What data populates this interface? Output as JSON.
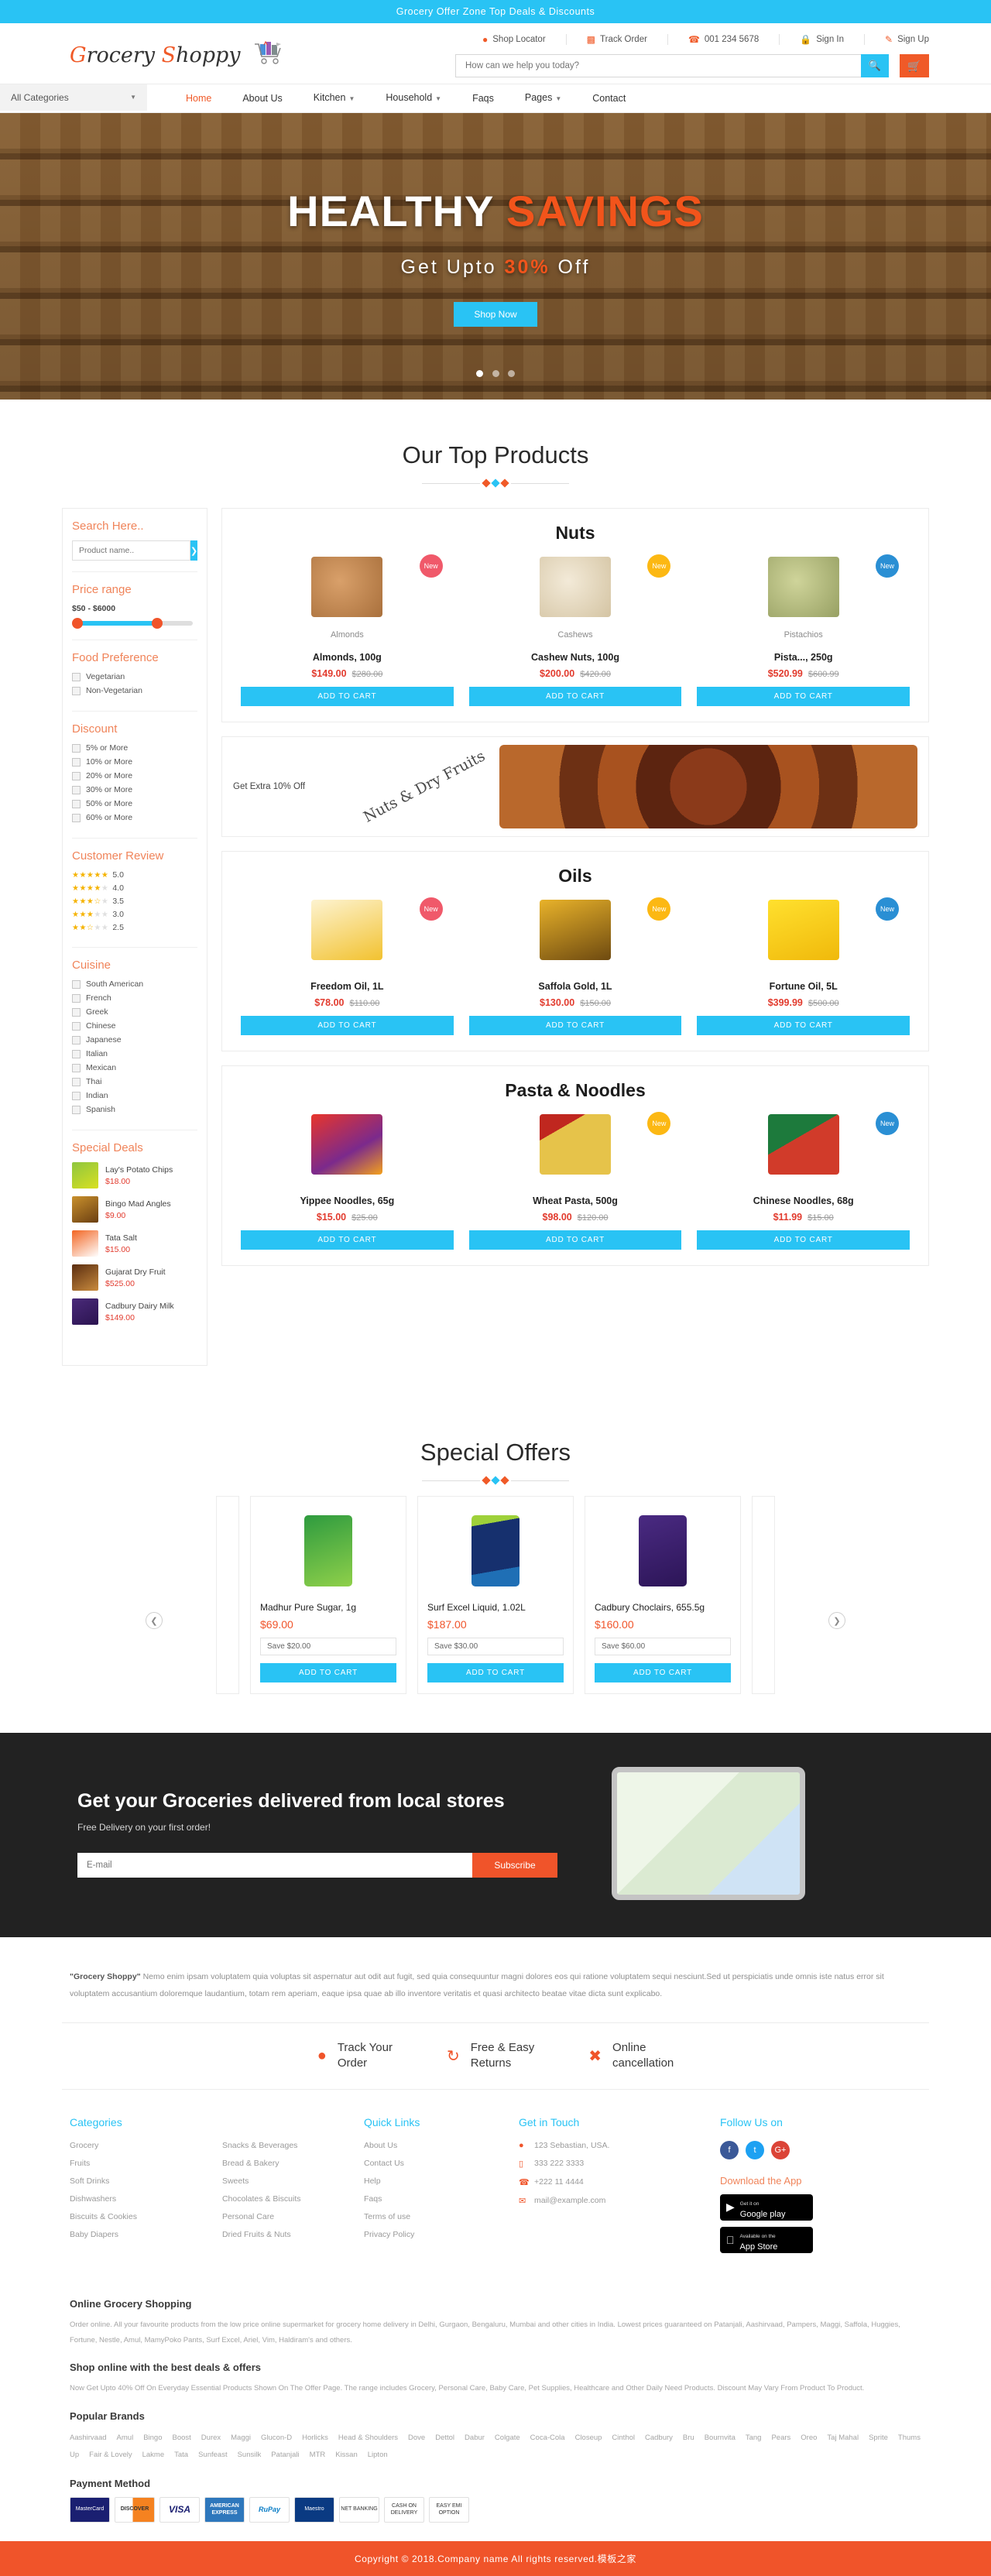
{
  "announcement": "Grocery Offer Zone Top Deals & Discounts",
  "brand": {
    "part1": "G",
    "part2": "rocery ",
    "part3": "S",
    "part4": "hoppy",
    "cart_icon": "shopping-cart-icon"
  },
  "utility": [
    {
      "icon": "location-pin-icon",
      "label": "Shop Locator"
    },
    {
      "icon": "truck-icon",
      "label": "Track Order"
    },
    {
      "icon": "phone-icon",
      "label": "001 234 5678"
    },
    {
      "icon": "lock-icon",
      "label": "Sign In"
    },
    {
      "icon": "pencil-icon",
      "label": "Sign Up"
    }
  ],
  "search": {
    "placeholder": "How can we help you today?",
    "value": "",
    "button_icon": "search-icon"
  },
  "cart_button": {
    "icon": "cart-icon"
  },
  "nav": {
    "categories_label": "All Categories",
    "links": [
      {
        "label": "Home",
        "active": true,
        "caret": false
      },
      {
        "label": "About Us",
        "active": false,
        "caret": false
      },
      {
        "label": "Kitchen",
        "active": false,
        "caret": true
      },
      {
        "label": "Household",
        "active": false,
        "caret": true
      },
      {
        "label": "Faqs",
        "active": false,
        "caret": false
      },
      {
        "label": "Pages",
        "active": false,
        "caret": true
      },
      {
        "label": "Contact",
        "active": false,
        "caret": false
      }
    ]
  },
  "hero": {
    "title_white": "HEALTHY ",
    "title_orange": "SAVINGS",
    "subtitle_pre": "Get Upto ",
    "subtitle_strong": "30%",
    "subtitle_post": " Off",
    "button": "Shop Now",
    "dots": 3,
    "active_dot": 0
  },
  "top_products": {
    "title": "Our Top Products"
  },
  "sidebar": {
    "search_title": "Search Here..",
    "search_placeholder": "Product name..",
    "search_button_icon": "chevron-right-icon",
    "price_title": "Price range",
    "price_min": "$50",
    "price_sep": "-",
    "price_max": "$6000",
    "food_title": "Food Preference",
    "food_options": [
      "Vegetarian",
      "Non-Vegetarian"
    ],
    "discount_title": "Discount",
    "discount_options": [
      "5% or More",
      "10% or More",
      "20% or More",
      "30% or More",
      "50% or More",
      "60% or More"
    ],
    "review_title": "Customer Review",
    "reviews": [
      {
        "full": 5,
        "half": 0,
        "value": "5.0"
      },
      {
        "full": 4,
        "half": 0,
        "value": "4.0"
      },
      {
        "full": 3,
        "half": 1,
        "value": "3.5"
      },
      {
        "full": 3,
        "half": 0,
        "value": "3.0"
      },
      {
        "full": 2,
        "half": 1,
        "value": "2.5"
      }
    ],
    "cuisine_title": "Cuisine",
    "cuisine_options": [
      "South American",
      "French",
      "Greek",
      "Chinese",
      "Japanese",
      "Italian",
      "Mexican",
      "Thai",
      "Indian",
      "Spanish"
    ],
    "deals_title": "Special Deals",
    "deals": [
      {
        "name": "Lay's Potato Chips",
        "price": "$18.00"
      },
      {
        "name": "Bingo Mad Angles",
        "price": "$9.00"
      },
      {
        "name": "Tata Salt",
        "price": "$15.00"
      },
      {
        "name": "Gujarat Dry Fruit",
        "price": "$525.00"
      },
      {
        "name": "Cadbury Dairy Milk",
        "price": "$149.00"
      }
    ]
  },
  "panels": [
    {
      "title": "Nuts",
      "products": [
        {
          "caption": "Almonds",
          "name": "Almonds, 100g",
          "price": "$149.00",
          "old_price": "$280.00",
          "badge": "New",
          "badge_color": "red",
          "cta": "ADD TO CART"
        },
        {
          "caption": "Cashews",
          "name": "Cashew Nuts, 100g",
          "price": "$200.00",
          "old_price": "$420.00",
          "badge": "New",
          "badge_color": "yel",
          "cta": "ADD TO CART"
        },
        {
          "caption": "Pistachios",
          "name": "Pista..., 250g",
          "price": "$520.99",
          "old_price": "$600.99",
          "badge": "New",
          "badge_color": "blu",
          "cta": "ADD TO CART"
        }
      ]
    },
    {
      "title": "Oils",
      "products": [
        {
          "caption": "",
          "name": "Freedom Oil, 1L",
          "price": "$78.00",
          "old_price": "$110.00",
          "badge": "New",
          "badge_color": "red",
          "cta": "ADD TO CART"
        },
        {
          "caption": "",
          "name": "Saffola Gold, 1L",
          "price": "$130.00",
          "old_price": "$150.00",
          "badge": "New",
          "badge_color": "yel",
          "cta": "ADD TO CART"
        },
        {
          "caption": "",
          "name": "Fortune Oil, 5L",
          "price": "$399.99",
          "old_price": "$500.00",
          "badge": "New",
          "badge_color": "blu",
          "cta": "ADD TO CART"
        }
      ]
    },
    {
      "title": "Pasta & Noodles",
      "products": [
        {
          "caption": "",
          "name": "Yippee Noodles, 65g",
          "price": "$15.00",
          "old_price": "$25.00",
          "badge": "",
          "badge_color": "",
          "cta": "ADD TO CART"
        },
        {
          "caption": "",
          "name": "Wheat Pasta, 500g",
          "price": "$98.00",
          "old_price": "$120.00",
          "badge": "New",
          "badge_color": "yel",
          "cta": "ADD TO CART"
        },
        {
          "caption": "",
          "name": "Chinese Noodles, 68g",
          "price": "$11.99",
          "old_price": "$15.00",
          "badge": "New",
          "badge_color": "blu",
          "cta": "ADD TO CART"
        }
      ]
    }
  ],
  "promo": {
    "text": "Get Extra 10% Off",
    "word": "Nuts & Dry Fruits"
  },
  "special_offers": {
    "title": "Special Offers",
    "prev_icon": "chevron-left-icon",
    "next_icon": "chevron-right-icon",
    "items": [
      {
        "name": "Madhur Pure Sugar, 1g",
        "price": "$69.00",
        "save": "Save $20.00",
        "cta": "ADD TO CART"
      },
      {
        "name": "Surf Excel Liquid, 1.02L",
        "price": "$187.00",
        "save": "Save $30.00",
        "cta": "ADD TO CART"
      },
      {
        "name": "Cadbury Choclairs, 655.5g",
        "price": "$160.00",
        "save": "Save $60.00",
        "cta": "ADD TO CART"
      }
    ]
  },
  "newsletter": {
    "title": "Get your Groceries delivered from local stores",
    "subtitle": "Free Delivery on your first order!",
    "placeholder": "E-mail",
    "value": "",
    "button": "Subscribe"
  },
  "footer": {
    "about_brand": "\"Grocery Shoppy\"",
    "about_text": " Nemo enim ipsam voluptatem quia voluptas sit aspernatur aut odit aut fugit, sed quia consequuntur magni dolores eos qui ratione voluptatem sequi nesciunt.Sed ut perspiciatis unde omnis iste natus error sit voluptatem accusantium doloremque laudantium, totam rem aperiam, eaque ipsa quae ab illo inventore veritatis et quasi architecto beatae vitae dicta sunt explicabo.",
    "features": [
      {
        "icon": "location-pin-icon",
        "line1": "Track Your",
        "line2": "Order"
      },
      {
        "icon": "refresh-icon",
        "line1": "Free & Easy",
        "line2": "Returns"
      },
      {
        "icon": "close-x-icon",
        "line1": "Online",
        "line2": "cancellation"
      }
    ],
    "categories_title": "Categories",
    "categories_col1": [
      "Grocery",
      "Fruits",
      "Soft Drinks",
      "Dishwashers",
      "Biscuits & Cookies",
      "Baby Diapers"
    ],
    "categories_col2": [
      "Snacks & Beverages",
      "Bread & Bakery",
      "Sweets",
      "Chocolates & Biscuits",
      "Personal Care",
      "Dried Fruits & Nuts"
    ],
    "quick_title": "Quick Links",
    "quick_links": [
      "About Us",
      "Contact Us",
      "Help",
      "Faqs",
      "Terms of use",
      "Privacy Policy"
    ],
    "touch_title": "Get in Touch",
    "touch_items": [
      {
        "icon": "location-pin-icon",
        "label": "123 Sebastian, USA."
      },
      {
        "icon": "mobile-icon",
        "label": "333 222 3333"
      },
      {
        "icon": "phone-icon",
        "label": "+222 11 4444"
      },
      {
        "icon": "envelope-icon",
        "label": "mail@example.com"
      }
    ],
    "social_title": "Follow Us on",
    "socials": [
      {
        "name": "facebook-icon",
        "glyph": "f"
      },
      {
        "name": "twitter-icon",
        "glyph": "t"
      },
      {
        "name": "google-plus-icon",
        "glyph": "G+"
      }
    ],
    "download_title": "Download the App",
    "stores": [
      {
        "icon": "google-play-icon",
        "small": "Get it on",
        "big": "Google play"
      },
      {
        "icon": "apple-icon",
        "small": "Available on the",
        "big": "App Store"
      }
    ],
    "seo": [
      {
        "heading": "Online Grocery Shopping",
        "body": "Order online. All your favourite products from the low price online supermarket for grocery home delivery in Delhi, Gurgaon, Bengaluru, Mumbai and other cities in India. Lowest prices guaranteed on Patanjali, Aashirvaad, Pampers, Maggi, Saffola, Huggies, Fortune, Nestle, Amul, MamyPoko Pants, Surf Excel, Ariel, Vim, Haldiram's and others."
      },
      {
        "heading": "Shop online with the best deals & offers",
        "body": "Now Get Upto 40% Off On Everyday Essential Products Shown On The Offer Page. The range includes Grocery, Personal Care, Baby Care, Pet Supplies, Healthcare and Other Daily Need Products. Discount May Vary From Product To Product."
      }
    ],
    "brands_title": "Popular Brands",
    "brands": [
      "Aashirvaad",
      "Amul",
      "Bingo",
      "Boost",
      "Durex",
      "Maggi",
      "Glucon-D",
      "Horlicks",
      "Head & Shoulders",
      "Dove",
      "Dettol",
      "Dabur",
      "Colgate",
      "Coca-Cola",
      "Closeup",
      "Cinthol",
      "Cadbury",
      "Bru",
      "Bournvita",
      "Tang",
      "Pears",
      "Oreo",
      "Taj Mahal",
      "Sprite",
      "Thums Up",
      "Fair & Lovely",
      "Lakme",
      "Tata",
      "Sunfeast",
      "Sunsilk",
      "Patanjali",
      "MTR",
      "Kissan",
      "Lipton"
    ],
    "payment_title": "Payment Method",
    "payments": [
      {
        "name": "mastercard-icon",
        "label": "MasterCard"
      },
      {
        "name": "discover-icon",
        "label": "DISCOVER"
      },
      {
        "name": "visa-icon",
        "label": "VISA"
      },
      {
        "name": "amex-icon",
        "label": "AMERICAN EXPRESS"
      },
      {
        "name": "rupay-icon",
        "label": "RuPay"
      },
      {
        "name": "maestro-icon",
        "label": "Maestro"
      },
      {
        "name": "net-banking-icon",
        "label": "NET BANKING"
      },
      {
        "name": "cash-on-delivery-icon",
        "label": "CASH ON DELIVERY"
      },
      {
        "name": "easy-emi-icon",
        "label": "EASY EMI OPTION"
      }
    ]
  },
  "copyright": "Copyright © 2018.Company name All rights reserved.模板之家"
}
